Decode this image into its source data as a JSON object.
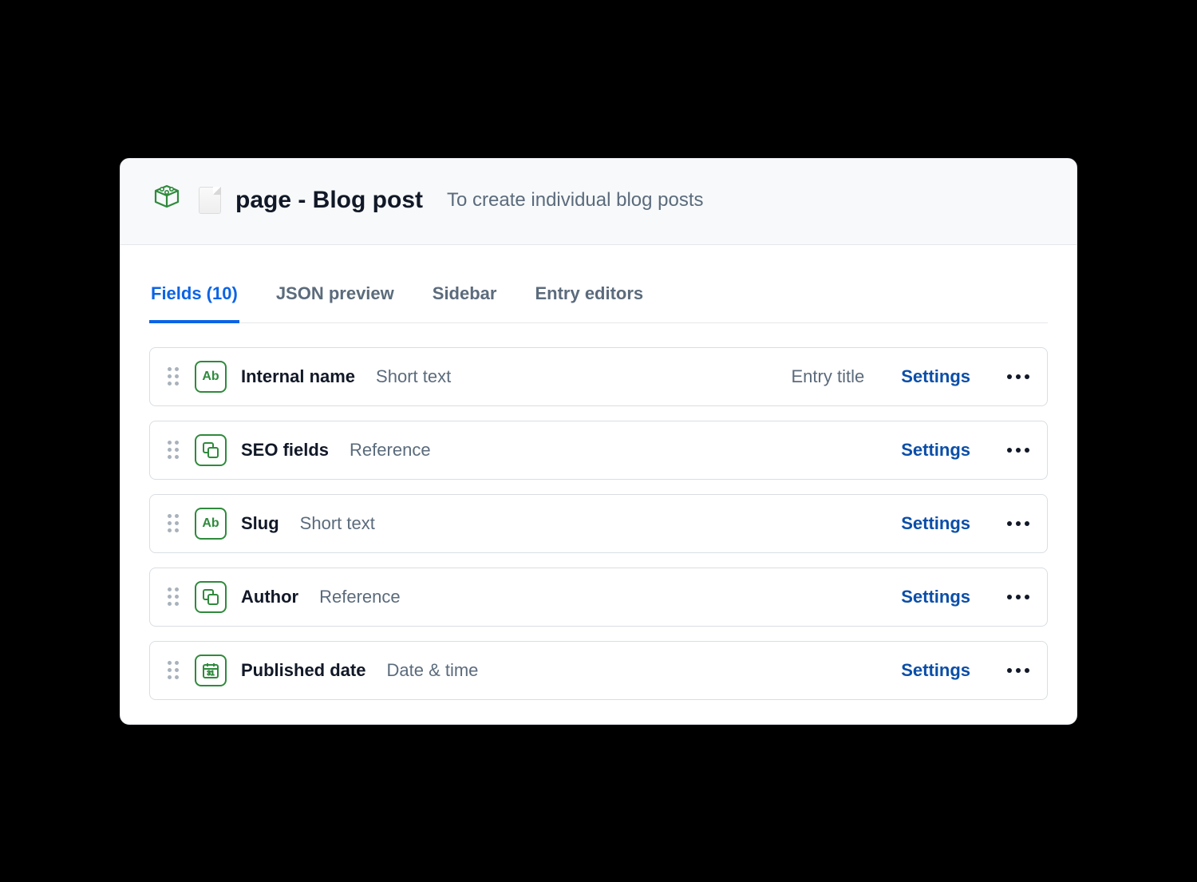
{
  "header": {
    "title": "page - Blog post",
    "subtitle": "To create individual blog posts"
  },
  "tabs": [
    {
      "label": "Fields (10)",
      "active": true
    },
    {
      "label": "JSON preview",
      "active": false
    },
    {
      "label": "Sidebar",
      "active": false
    },
    {
      "label": "Entry editors",
      "active": false
    }
  ],
  "actions": {
    "settings": "Settings"
  },
  "icons": {
    "text": "Ab",
    "reference": "reference-icon",
    "date": "calendar-icon"
  },
  "fields": [
    {
      "name": "Internal name",
      "type": "Short text",
      "icon": "text",
      "badge": "Entry title"
    },
    {
      "name": "SEO fields",
      "type": "Reference",
      "icon": "reference",
      "badge": ""
    },
    {
      "name": "Slug",
      "type": "Short text",
      "icon": "text",
      "badge": ""
    },
    {
      "name": "Author",
      "type": "Reference",
      "icon": "reference",
      "badge": ""
    },
    {
      "name": "Published date",
      "type": "Date & time",
      "icon": "date",
      "badge": ""
    }
  ]
}
